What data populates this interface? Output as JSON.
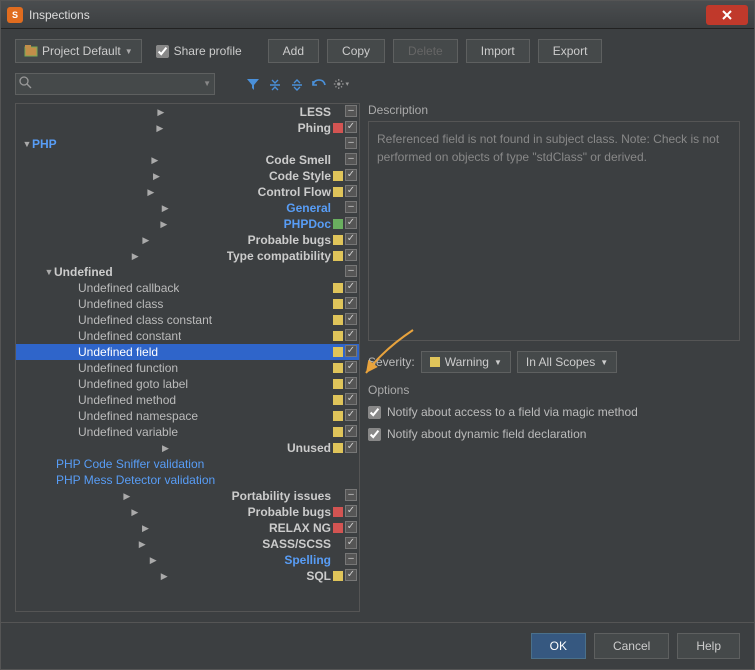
{
  "window": {
    "title": "Inspections"
  },
  "toolbar": {
    "profile_label": "Project Default",
    "share_profile": "Share profile",
    "add": "Add",
    "copy": "Copy",
    "delete": "Delete",
    "import": "Import",
    "export": "Export"
  },
  "search": {
    "placeholder": ""
  },
  "tree": [
    {
      "indent": 0,
      "arrow": "right",
      "label": "LESS",
      "style": "bold",
      "sev": "",
      "chk": "mixed"
    },
    {
      "indent": 0,
      "arrow": "right",
      "label": "Phing",
      "style": "bold",
      "sev": "red",
      "chk": "on"
    },
    {
      "indent": 0,
      "arrow": "down",
      "label": "PHP",
      "style": "blue",
      "sev": "",
      "chk": "mixed"
    },
    {
      "indent": 1,
      "arrow": "right",
      "label": "Code Smell",
      "style": "bold",
      "sev": "",
      "chk": "mixed"
    },
    {
      "indent": 1,
      "arrow": "right",
      "label": "Code Style",
      "style": "bold",
      "sev": "yellow",
      "chk": "on"
    },
    {
      "indent": 1,
      "arrow": "right",
      "label": "Control Flow",
      "style": "bold",
      "sev": "yellow",
      "chk": "on"
    },
    {
      "indent": 1,
      "arrow": "right",
      "label": "General",
      "style": "blue",
      "sev": "",
      "chk": "mixed"
    },
    {
      "indent": 1,
      "arrow": "right",
      "label": "PHPDoc",
      "style": "blue",
      "sev": "green",
      "chk": "on"
    },
    {
      "indent": 1,
      "arrow": "right",
      "label": "Probable bugs",
      "style": "bold",
      "sev": "yellow",
      "chk": "on"
    },
    {
      "indent": 1,
      "arrow": "right",
      "label": "Type compatibility",
      "style": "bold",
      "sev": "yellow",
      "chk": "on"
    },
    {
      "indent": 1,
      "arrow": "down",
      "label": "Undefined",
      "style": "bold",
      "sev": "",
      "chk": "mixed"
    },
    {
      "indent": 2,
      "arrow": "",
      "label": "Undefined callback",
      "style": "",
      "sev": "yellow",
      "chk": "on"
    },
    {
      "indent": 2,
      "arrow": "",
      "label": "Undefined class",
      "style": "",
      "sev": "yellow",
      "chk": "on"
    },
    {
      "indent": 2,
      "arrow": "",
      "label": "Undefined class constant",
      "style": "",
      "sev": "yellow",
      "chk": "on"
    },
    {
      "indent": 2,
      "arrow": "",
      "label": "Undefined constant",
      "style": "",
      "sev": "yellow",
      "chk": "on"
    },
    {
      "indent": 2,
      "arrow": "",
      "label": "Undefined field",
      "style": "sel",
      "sev": "yellow",
      "chk": "on",
      "selected": true
    },
    {
      "indent": 2,
      "arrow": "",
      "label": "Undefined function",
      "style": "",
      "sev": "yellow",
      "chk": "on"
    },
    {
      "indent": 2,
      "arrow": "",
      "label": "Undefined goto label",
      "style": "",
      "sev": "yellow",
      "chk": "on"
    },
    {
      "indent": 2,
      "arrow": "",
      "label": "Undefined method",
      "style": "",
      "sev": "yellow",
      "chk": "on"
    },
    {
      "indent": 2,
      "arrow": "",
      "label": "Undefined namespace",
      "style": "",
      "sev": "yellow",
      "chk": "on"
    },
    {
      "indent": 2,
      "arrow": "",
      "label": "Undefined variable",
      "style": "",
      "sev": "yellow",
      "chk": "on"
    },
    {
      "indent": 1,
      "arrow": "right",
      "label": "Unused",
      "style": "bold",
      "sev": "yellow",
      "chk": "on"
    },
    {
      "indent": 1,
      "arrow": "",
      "label": "PHP Code Sniffer validation",
      "style": "blue-nb",
      "sev": "",
      "chk": ""
    },
    {
      "indent": 1,
      "arrow": "",
      "label": "PHP Mess Detector validation",
      "style": "blue-nb",
      "sev": "",
      "chk": ""
    },
    {
      "indent": 0,
      "arrow": "right",
      "label": "Portability issues",
      "style": "bold",
      "sev": "",
      "chk": "mixed"
    },
    {
      "indent": 0,
      "arrow": "right",
      "label": "Probable bugs",
      "style": "bold",
      "sev": "red",
      "chk": "on"
    },
    {
      "indent": 0,
      "arrow": "right",
      "label": "RELAX NG",
      "style": "bold",
      "sev": "red",
      "chk": "on"
    },
    {
      "indent": 0,
      "arrow": "right",
      "label": "SASS/SCSS",
      "style": "bold",
      "sev": "",
      "chk": "on"
    },
    {
      "indent": 0,
      "arrow": "right",
      "label": "Spelling",
      "style": "blue",
      "sev": "",
      "chk": "mixed"
    },
    {
      "indent": 0,
      "arrow": "right",
      "label": "SQL",
      "style": "bold",
      "sev": "yellow",
      "chk": "on"
    }
  ],
  "description": {
    "title": "Description",
    "text": "Referenced field is not found in subject class. Note: Check is not performed on objects of type \"stdClass\" or derived."
  },
  "severity": {
    "label": "Severity:",
    "value": "Warning",
    "scope": "In All Scopes"
  },
  "options": {
    "title": "Options",
    "opt1": "Notify about access to a field via magic method",
    "opt2": "Notify about dynamic field declaration"
  },
  "footer": {
    "ok": "OK",
    "cancel": "Cancel",
    "help": "Help"
  }
}
